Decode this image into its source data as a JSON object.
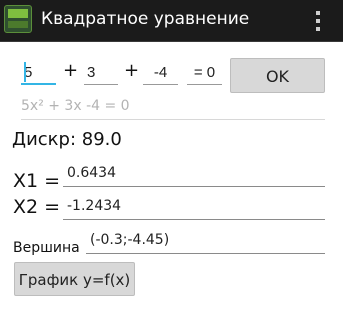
{
  "app_bar": {
    "title": "Квадратное уравнение",
    "icon": "app-logo-icon",
    "overflow_icon": "overflow-menu-icon"
  },
  "coefficients": {
    "a": "5",
    "b": "3",
    "c": "-4",
    "d": "= 0",
    "operator_1": "+",
    "operator_2": "+"
  },
  "solve_button": {
    "label": "OK"
  },
  "equation_hint": "5x² + 3x -4 = 0",
  "discriminant": "Дискр: 89.0",
  "roots": {
    "x1_label": "X1 =",
    "x1_value": "0.6434",
    "x2_label": "X2 =",
    "x2_value": "-1.2434"
  },
  "vertex": {
    "label": "Вершина",
    "value": "(-0.3;-4.45)"
  },
  "graph_button": {
    "label": "График y=f(x)"
  },
  "colors": {
    "accent": "#33b5e5",
    "title_bar": "#1b1b1b",
    "button": "#d8d8d8"
  }
}
